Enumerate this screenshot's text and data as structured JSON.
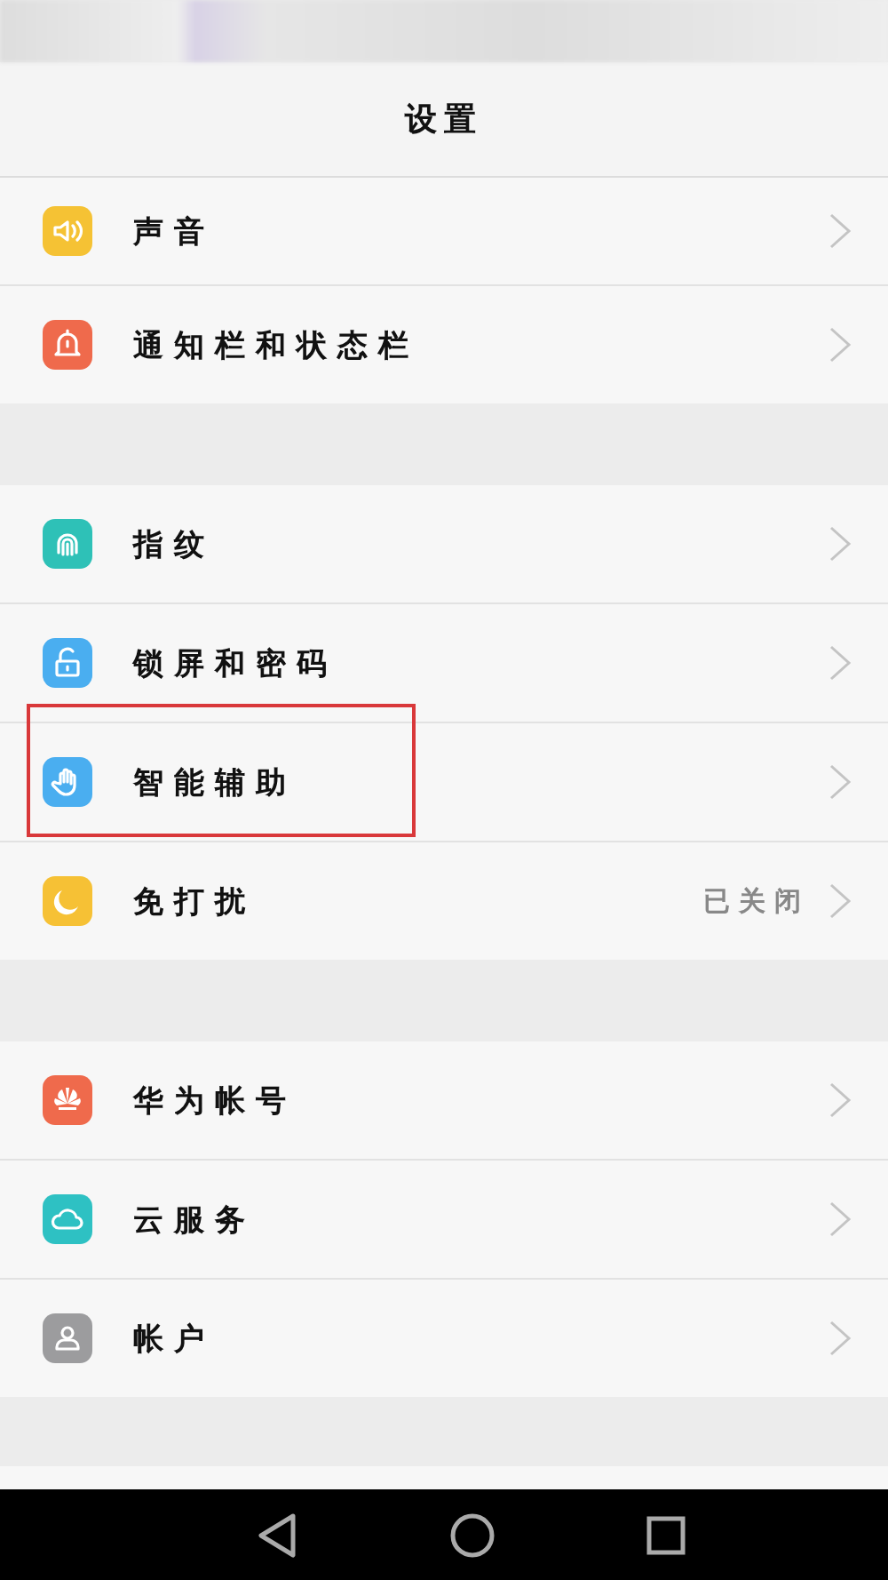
{
  "header": {
    "title": "设置"
  },
  "sections": [
    {
      "items": [
        {
          "label": "声音",
          "kind": "sound",
          "color": "#f5c234",
          "highlighted": false
        },
        {
          "label": "通知栏和状态栏",
          "kind": "bell",
          "color": "#ef6a4c",
          "highlighted": false
        }
      ]
    },
    {
      "items": [
        {
          "label": "指纹",
          "kind": "fingerprint",
          "color": "#2ec1b7",
          "highlighted": false
        },
        {
          "label": "锁屏和密码",
          "kind": "lock",
          "color": "#4aaef0",
          "highlighted": false
        },
        {
          "label": "智能辅助",
          "kind": "hand",
          "color": "#4aaef0",
          "highlighted": true
        },
        {
          "label": "免打扰",
          "kind": "moon",
          "color": "#f6c135",
          "value": "已关闭",
          "highlighted": false
        }
      ]
    },
    {
      "items": [
        {
          "label": "华为帐号",
          "kind": "logo",
          "color": "#ef6a4c",
          "highlighted": false
        },
        {
          "label": "云服务",
          "kind": "cloud",
          "color": "#2ec1c3",
          "highlighted": false
        },
        {
          "label": "帐户",
          "kind": "person",
          "color": "#9c9c9e",
          "highlighted": false
        }
      ]
    }
  ]
}
